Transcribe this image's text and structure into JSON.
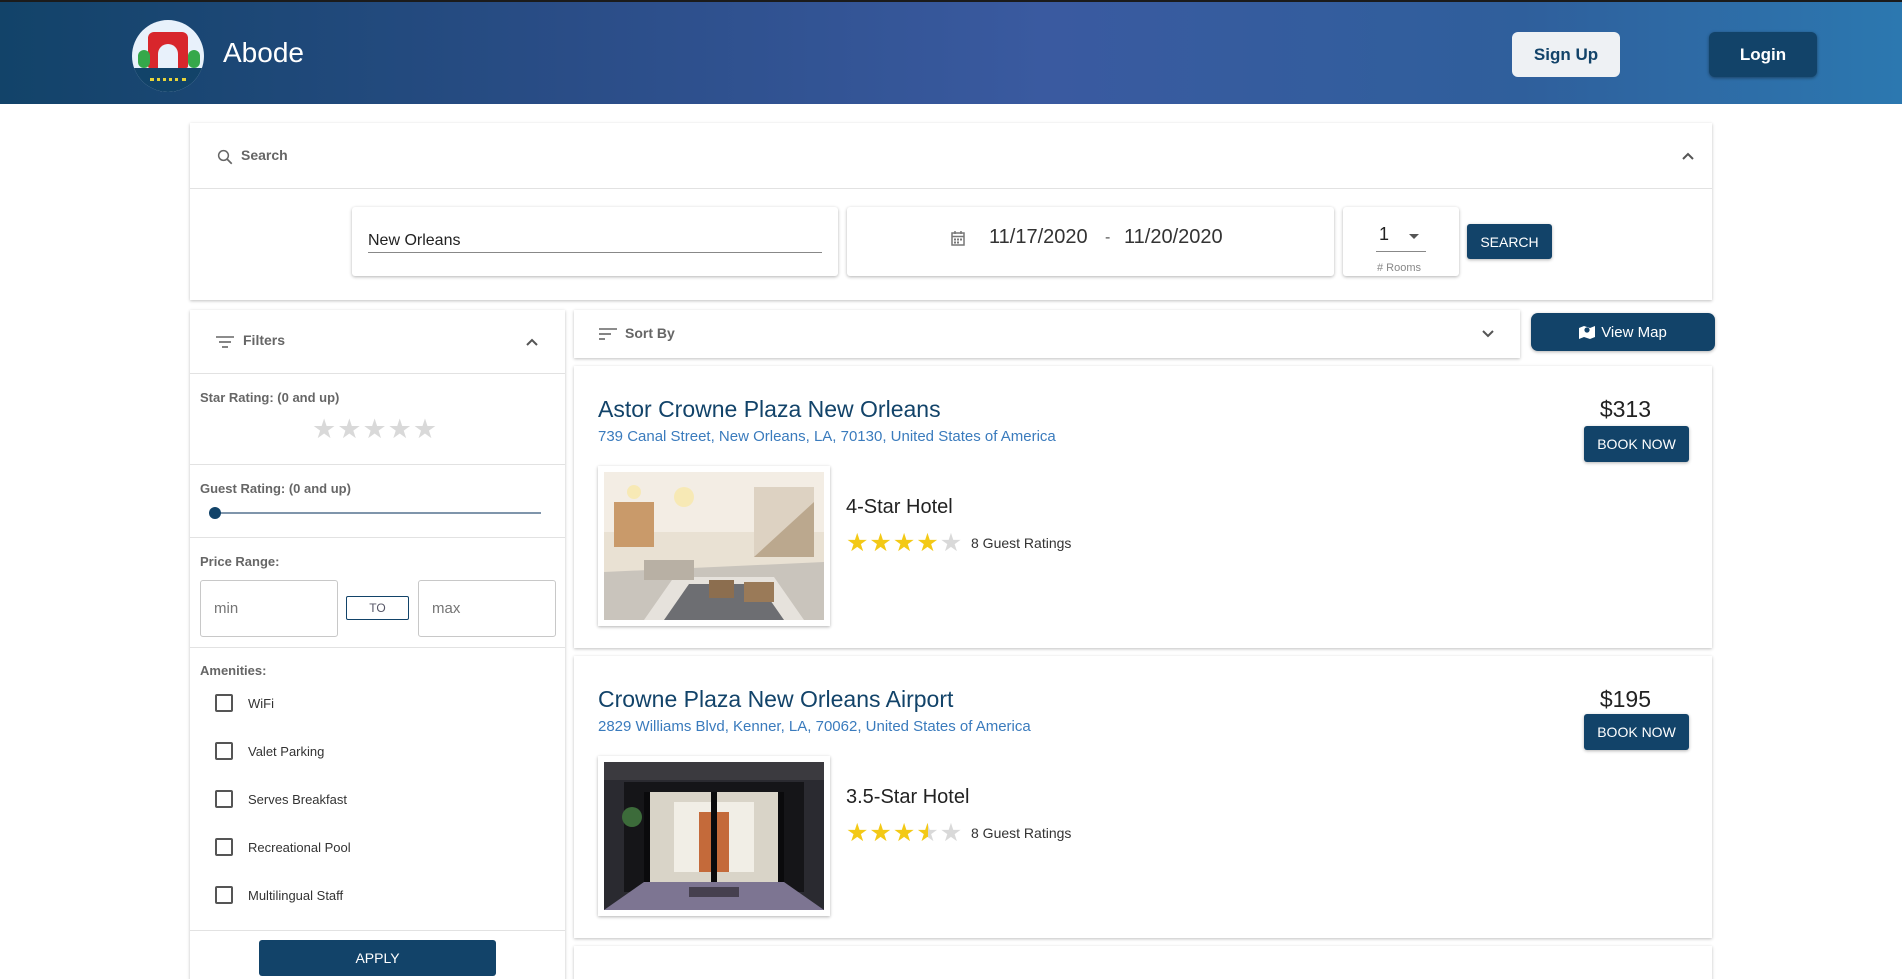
{
  "header": {
    "brand": "Abode",
    "signup_label": "Sign Up",
    "login_label": "Login"
  },
  "search": {
    "title": "Search",
    "location_value": "New Orleans",
    "date_start": "11/17/2020",
    "date_separator": "-",
    "date_end": "11/20/2020",
    "rooms_value": "1",
    "rooms_caption": "# Rooms",
    "button_label": "SEARCH"
  },
  "filters": {
    "title": "Filters",
    "star_rating_label": "Star Rating: (0 and up)",
    "star_rating_value": 0,
    "guest_rating_label": "Guest Rating: (0 and up)",
    "guest_rating_value": 0,
    "price_range_label": "Price Range:",
    "min_placeholder": "min",
    "max_placeholder": "max",
    "to_label": "TO",
    "amenities_label": "Amenities:",
    "amenities": [
      {
        "label": "WiFi",
        "checked": false
      },
      {
        "label": "Valet Parking",
        "checked": false
      },
      {
        "label": "Serves Breakfast",
        "checked": false
      },
      {
        "label": "Recreational Pool",
        "checked": false
      },
      {
        "label": "Multilingual Staff",
        "checked": false
      }
    ],
    "apply_label": "APPLY"
  },
  "sort": {
    "title": "Sort By"
  },
  "view_map_label": "View Map",
  "hotels": [
    {
      "name": "Astor Crowne Plaza New Orleans",
      "address": "739 Canal Street, New Orleans, LA, 70130, United States of America",
      "price": "$313",
      "book_label": "BOOK NOW",
      "class_label": "4-Star Hotel",
      "stars": 4,
      "reviews": "8 Guest Ratings"
    },
    {
      "name": "Crowne Plaza New Orleans Airport",
      "address": "2829 Williams Blvd, Kenner, LA, 70062, United States of America",
      "price": "$195",
      "book_label": "BOOK NOW",
      "class_label": "3.5-Star Hotel",
      "stars": 3.5,
      "reviews": "8 Guest Ratings"
    }
  ],
  "colors": {
    "primary": "#124369",
    "link": "#3a7bbd",
    "star": "#f3c916"
  }
}
